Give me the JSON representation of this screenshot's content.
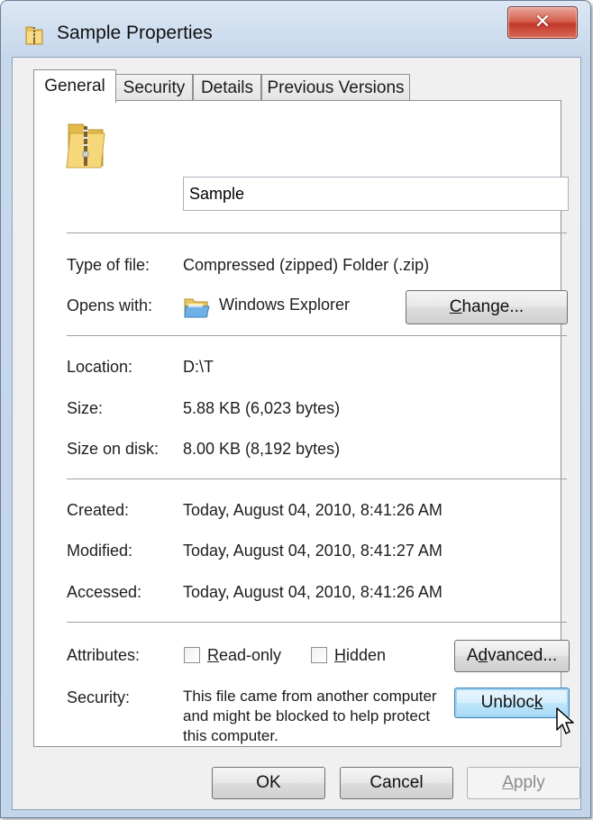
{
  "window": {
    "title": "Sample Properties",
    "close_label": "✕"
  },
  "tabs": [
    {
      "label": "General",
      "active": true
    },
    {
      "label": "Security",
      "active": false
    },
    {
      "label": "Details",
      "active": false
    },
    {
      "label": "Previous Versions",
      "active": false
    }
  ],
  "general": {
    "file_name": "Sample",
    "type_label": "Type of file:",
    "type_value": "Compressed (zipped) Folder (.zip)",
    "opens_label": "Opens with:",
    "opens_value": "Windows Explorer",
    "change_button": {
      "prefix": "",
      "mnemonic": "C",
      "rest": "hange..."
    },
    "location_label": "Location:",
    "location_value": "D:\\T",
    "size_label": "Size:",
    "size_value": "5.88 KB (6,023 bytes)",
    "size_on_disk_label": "Size on disk:",
    "size_on_disk_value": "8.00 KB (8,192 bytes)",
    "created_label": "Created:",
    "created_value": "Today, August 04, 2010, 8:41:26 AM",
    "modified_label": "Modified:",
    "modified_value": "Today, August 04, 2010, 8:41:27 AM",
    "accessed_label": "Accessed:",
    "accessed_value": "Today, August 04, 2010, 8:41:26 AM",
    "attributes_label": "Attributes:",
    "readonly": {
      "mnemonic": "R",
      "rest": "ead-only",
      "checked": false
    },
    "hidden": {
      "mnemonic": "H",
      "rest": "idden",
      "checked": false
    },
    "advanced_button": {
      "prefix": "A",
      "mnemonic": "d",
      "rest": "vanced..."
    },
    "security_label": "Security:",
    "security_message": "This file came from another computer and might be blocked to help protect this computer.",
    "unblock_button": {
      "prefix": "Unbloc",
      "mnemonic": "k",
      "rest": ""
    }
  },
  "footer": {
    "ok_label": "OK",
    "cancel_label": "Cancel",
    "apply": {
      "mnemonic": "A",
      "rest": "pply",
      "enabled": false
    }
  },
  "icons": {
    "title": "zip-folder-icon",
    "file": "zip-folder-large-icon",
    "opens_with": "windows-explorer-icon",
    "cursor": "mouse-pointer-icon"
  },
  "colors": {
    "title_bar": "#c7d8ec",
    "close_button": "#c2382a",
    "focus_button": "#bee6fd",
    "folder": "#f2cf6a"
  }
}
